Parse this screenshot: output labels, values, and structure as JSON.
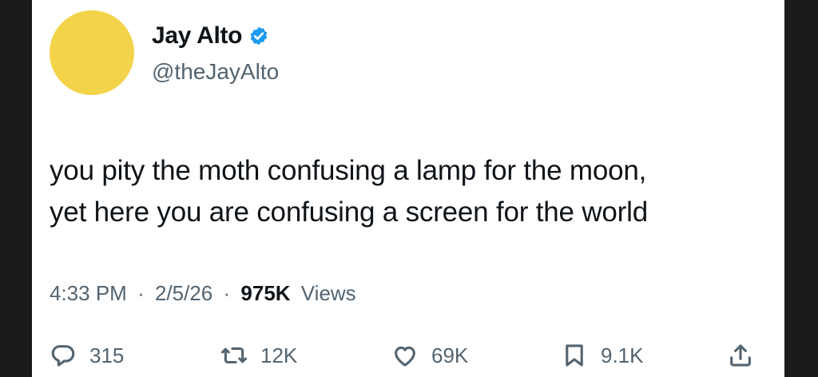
{
  "colors": {
    "avatar": "#f2d34a",
    "verified": "#1d9bf0",
    "text_primary": "#0f1419",
    "text_secondary": "#536471",
    "background": "#ffffff",
    "outer_frame": "#1b1b1b"
  },
  "author": {
    "display_name": "Jay Alto",
    "handle": "@theJayAlto",
    "verified_icon": "verified-badge-icon"
  },
  "tweet": {
    "lines": [
      "you pity the moth confusing a lamp for the moon,",
      "yet here you are confusing a screen for the world"
    ],
    "time": "4:33 PM",
    "separator": "·",
    "date": "2/5/26",
    "views_count": "975K",
    "views_label": "Views"
  },
  "actions": {
    "reply": {
      "icon": "reply-icon",
      "count": "315"
    },
    "repost": {
      "icon": "repost-icon",
      "count": "12K"
    },
    "like": {
      "icon": "like-icon",
      "count": "69K"
    },
    "bookmark": {
      "icon": "bookmark-icon",
      "count": "9.1K"
    },
    "share": {
      "icon": "share-icon"
    }
  }
}
